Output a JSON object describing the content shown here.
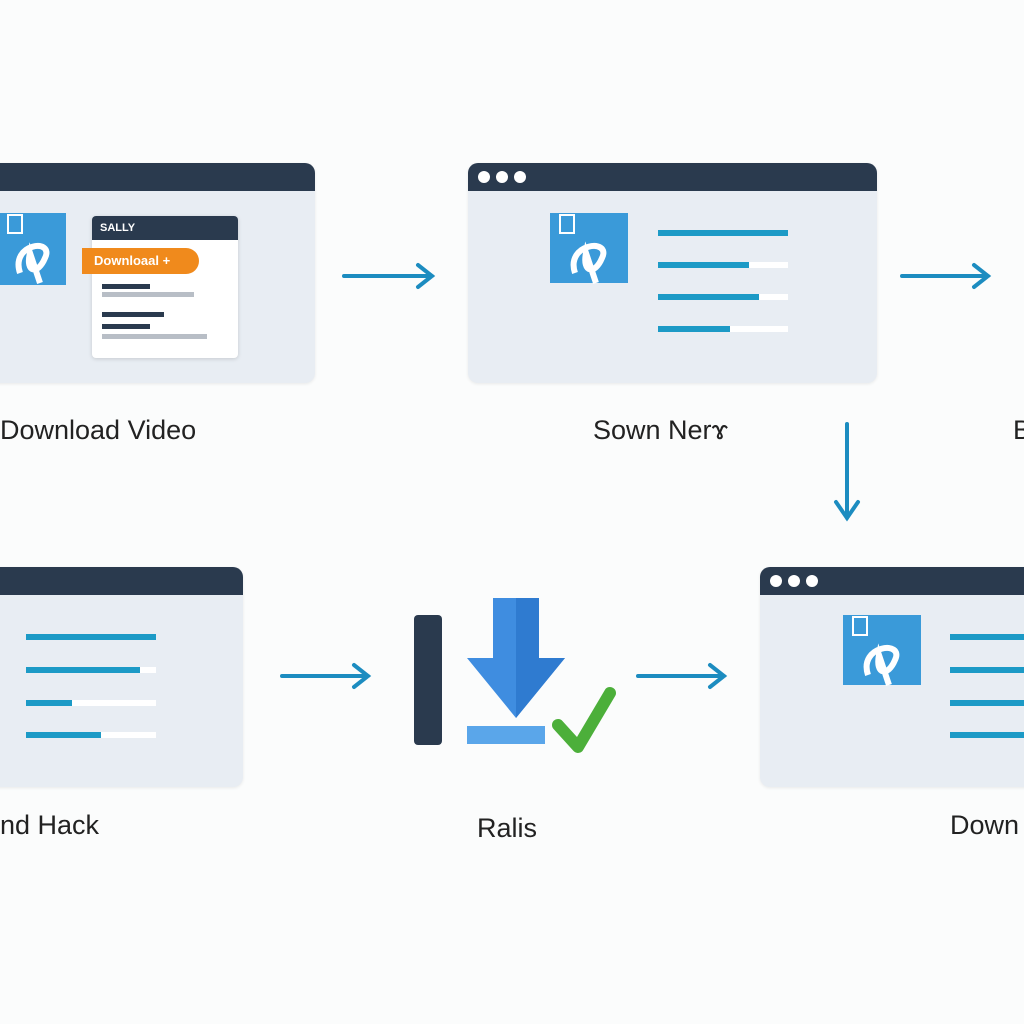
{
  "steps": [
    {
      "label": "Download Video",
      "card": {
        "title": "SALLY",
        "button": "Downloaal +"
      }
    },
    {
      "label": "Sown Nerɤ",
      "lines": [
        1,
        0.7,
        0.78,
        0.55
      ]
    },
    {
      "label": "B"
    },
    {
      "label": "nd Hack",
      "lines": [
        1,
        0.88,
        0.35,
        0.6
      ]
    },
    {
      "label": "Ralis"
    },
    {
      "label": "Down",
      "lines": [
        1,
        1,
        1,
        1
      ]
    }
  ],
  "colors": {
    "header": "#2a3a4e",
    "accent": "#1c9ac6",
    "orange": "#f08a1c",
    "check": "#4caf3a",
    "download": "#4a90e2"
  }
}
